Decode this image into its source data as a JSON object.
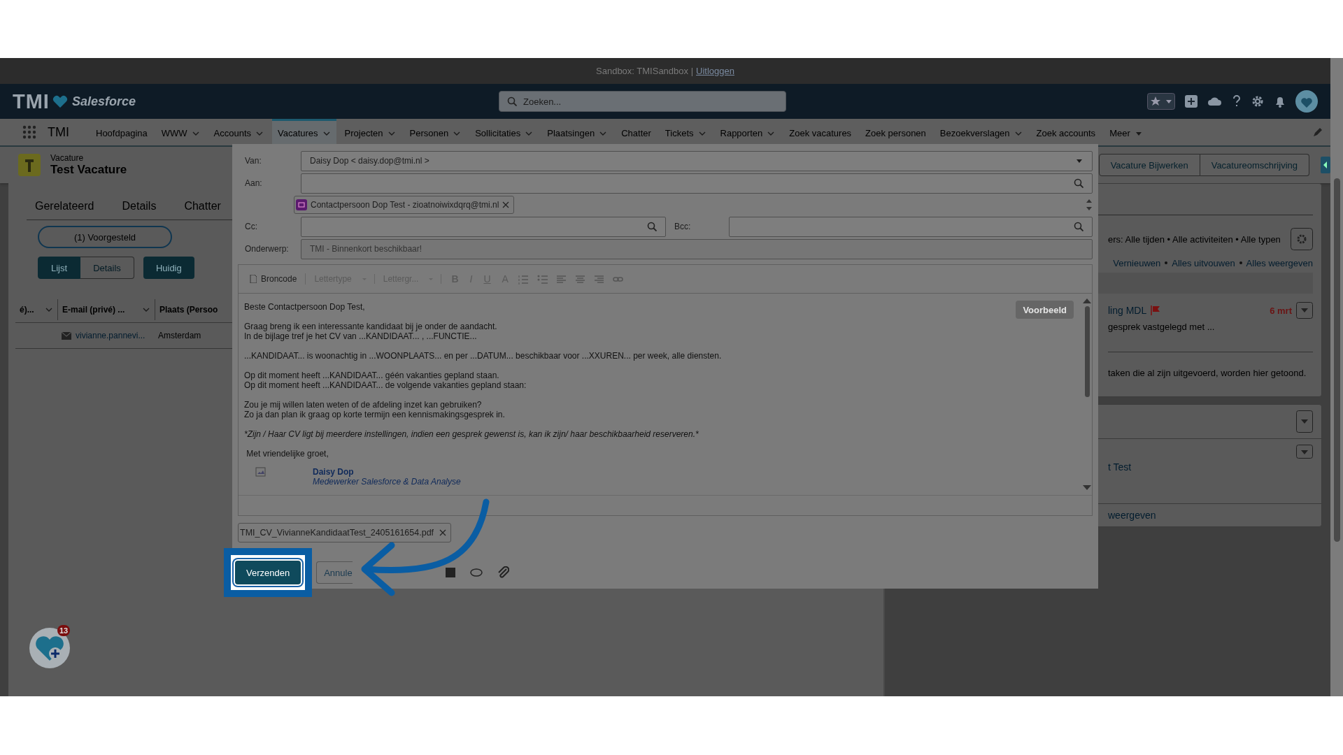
{
  "sandbox_bar": {
    "text": "Sandbox: TMISandbox |",
    "link": "Uitloggen"
  },
  "header": {
    "logo": "TMI",
    "brand": "Salesforce",
    "search": {
      "placeholder": "Zoeken..."
    }
  },
  "nav": {
    "app_name": "TMI",
    "items": [
      {
        "label": "Hoofdpagina",
        "dropdown": false,
        "selected": false
      },
      {
        "label": "WWW",
        "dropdown": true,
        "selected": false
      },
      {
        "label": "Accounts",
        "dropdown": true,
        "selected": false
      },
      {
        "label": "Vacatures",
        "dropdown": true,
        "selected": true
      },
      {
        "label": "Projecten",
        "dropdown": true,
        "selected": false
      },
      {
        "label": "Personen",
        "dropdown": true,
        "selected": false
      },
      {
        "label": "Sollicitaties",
        "dropdown": true,
        "selected": false
      },
      {
        "label": "Plaatsingen",
        "dropdown": true,
        "selected": false
      },
      {
        "label": "Chatter",
        "dropdown": false,
        "selected": false
      },
      {
        "label": "Tickets",
        "dropdown": true,
        "selected": false
      },
      {
        "label": "Rapporten",
        "dropdown": true,
        "selected": false
      },
      {
        "label": "Zoek vacatures",
        "dropdown": false,
        "selected": false
      },
      {
        "label": "Zoek personen",
        "dropdown": false,
        "selected": false
      },
      {
        "label": "Bezoekverslagen",
        "dropdown": true,
        "selected": false
      },
      {
        "label": "Zoek accounts",
        "dropdown": false,
        "selected": false
      },
      {
        "label": "Meer",
        "dropdown": true,
        "selected": false
      }
    ]
  },
  "record": {
    "object": "Vacature",
    "title": "Test Vacature",
    "actions": [
      "Vacature Bijwerken",
      "Vacatureomschrijving"
    ]
  },
  "left_panel": {
    "tabs": [
      {
        "label": "Gerelateerd",
        "selected": false
      },
      {
        "label": "Details",
        "selected": false
      },
      {
        "label": "Chatter",
        "selected": false
      }
    ],
    "filter_button": "(1) Voorgesteld",
    "view_toggle": [
      {
        "label": "Lijst",
        "selected": true
      },
      {
        "label": "Details",
        "selected": false
      }
    ],
    "current_button": "Huidig",
    "table": {
      "columns": [
        "é)...",
        "E-mail (privé) ...",
        "Plaats (Persoo"
      ],
      "rows": [
        [
          "",
          "vivianne.pannevi...",
          "Amsterdam"
        ]
      ]
    }
  },
  "right_panel": {
    "filters": "ers: Alle tijden • Alle activiteiten • Alle typen",
    "links": [
      "Vernieuwen",
      "Alles uitvouwen",
      "Alles weergeven"
    ],
    "task": {
      "title": "ling MDL",
      "date": "6 mrt",
      "description": "gesprek vastgelegd met ..."
    },
    "note": "taken die al zijn uitgevoerd, worden hier getoond.",
    "related_link": "t Test",
    "footer_link": "weergeven"
  },
  "email_dialog": {
    "from": {
      "label": "Van:",
      "value": "Daisy Dop < daisy.dop@tmi.nl >"
    },
    "to": {
      "label": "Aan:",
      "recipients": [
        "Contactpersoon Dop Test - zioatnoiwixdqrq@tmi.nl"
      ]
    },
    "cc": {
      "label": "Cc:"
    },
    "bcc": {
      "label": "Bcc:"
    },
    "subject": {
      "label": "Onderwerp:",
      "value": "TMI - Binnenkort beschikbaar!"
    },
    "toolbar": {
      "source": "Broncode",
      "font": "Lettertype",
      "size": "Lettergr...",
      "formats": [
        "B",
        "I",
        "U",
        "A"
      ]
    },
    "preview": "Voorbeeld",
    "body": [
      {
        "kind": "text",
        "lines": [
          "Beste Contactpersoon Dop Test,"
        ]
      },
      {
        "kind": "text",
        "lines": [
          "Graag breng ik een interessante kandidaat bij je onder de aandacht.",
          "In de bijlage tref je het CV van ...KANDIDAAT... , ...FUNCTIE..."
        ]
      },
      {
        "kind": "text",
        "lines": [
          "...KANDIDAAT... is woonachtig in ...WOONPLAATS... en per ...DATUM... beschikbaar voor ...XXUREN... per week, alle diensten."
        ]
      },
      {
        "kind": "text",
        "lines": [
          "Op dit moment heeft ...KANDIDAAT... géén vakanties gepland staan.",
          "Op dit moment heeft ...KANDIDAAT... de volgende vakanties gepland staan:"
        ]
      },
      {
        "kind": "text",
        "lines": [
          "Zou je mij willen laten weten of de afdeling inzet kan gebruiken?",
          "Zo ja dan plan ik graag op korte termijn een kennismakingsgesprek in."
        ]
      },
      {
        "kind": "italic",
        "lines": [
          "*Zijn / Haar CV ligt bij meerdere instellingen, indien een gesprek gewenst is, kan ik zijn/ haar beschikbaarheid reserveren.*"
        ]
      },
      {
        "kind": "text",
        "lines": [
          " Met vriendelijke groet,"
        ]
      }
    ],
    "signature": {
      "name": "Daisy Dop",
      "title": "Medewerker Salesforce & Data Analyse"
    },
    "attachments": [
      "TMI_CV_VivianneKandidaatTest_2405161654.pdf"
    ],
    "send": "Verzenden",
    "cancel": "Annule"
  },
  "utility": {
    "badge": "13"
  }
}
